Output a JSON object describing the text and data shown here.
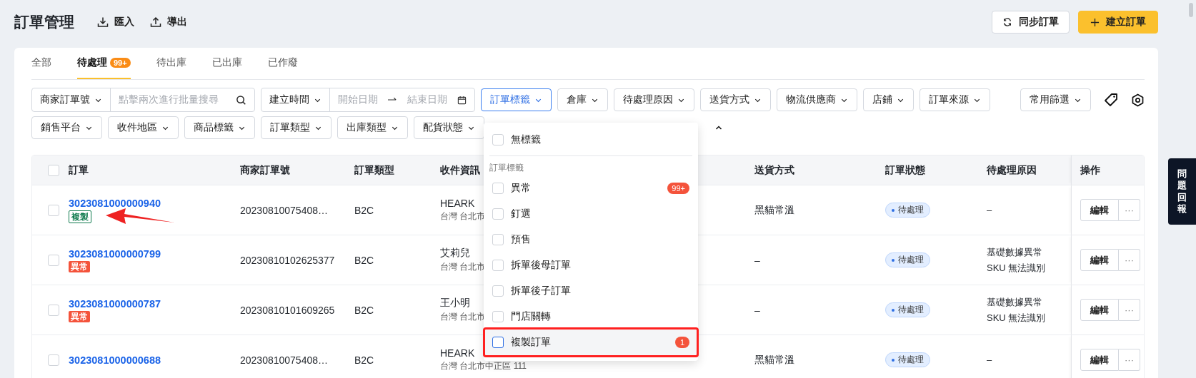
{
  "header": {
    "title": "訂單管理",
    "actions": [
      {
        "label": "匯入"
      },
      {
        "label": "導出"
      }
    ],
    "buttons": [
      {
        "label": "同步訂單",
        "kind": "secondary"
      },
      {
        "label": "建立訂單",
        "kind": "primary"
      }
    ]
  },
  "tabs": [
    {
      "label": "全部",
      "selected": false
    },
    {
      "label": "待處理",
      "selected": true,
      "badge": "99+"
    },
    {
      "label": "待出庫",
      "selected": false
    },
    {
      "label": "已出庫",
      "selected": false
    },
    {
      "label": "已作廢",
      "selected": false
    }
  ],
  "filters": {
    "row_1": [
      {
        "kind": "search",
        "label": "商家訂單號",
        "placeholder": "點擊兩次進行批量搜尋"
      },
      {
        "kind": "date",
        "label": "建立時間",
        "start_placeholder": "開始日期",
        "end_placeholder": "結束日期"
      },
      {
        "kind": "select",
        "label": "訂單標籤",
        "open": true
      },
      {
        "kind": "select",
        "label": "倉庫",
        "open": false
      },
      {
        "kind": "select",
        "label": "待處理原因",
        "open": false
      },
      {
        "kind": "select",
        "label": "送貨方式",
        "open": false
      },
      {
        "kind": "select",
        "label": "物流供應商",
        "open": false
      },
      {
        "kind": "select",
        "label": "店鋪",
        "open": false
      },
      {
        "kind": "select",
        "label": "訂單來源",
        "open": false
      }
    ],
    "saved_filters": "常用篩選",
    "row_2": [
      {
        "kind": "select",
        "label": "銷售平台",
        "open": false
      },
      {
        "kind": "select",
        "label": "收件地區",
        "open": false
      },
      {
        "kind": "select",
        "label": "商品標籤",
        "open": false
      },
      {
        "kind": "select",
        "label": "訂單類型",
        "open": false
      },
      {
        "kind": "select",
        "label": "出庫類型",
        "open": false
      },
      {
        "kind": "select",
        "label": "配貨狀態",
        "open": false
      }
    ]
  },
  "table": {
    "select_all_checked": false,
    "columns": [
      "訂單",
      "商家訂單號",
      "訂單類型",
      "收件資訊",
      "送貨方式",
      "訂單狀態",
      "待處理原因",
      "操作"
    ],
    "rows": [
      {
        "order": "3023081000000940",
        "tag": {
          "label": "複製",
          "kind": "copy"
        },
        "marked": true,
        "checked": false,
        "merchant_no": "20230810075408…",
        "type": "B2C",
        "recipient": "HEARK",
        "address": "台灣 台北市",
        "delivery": "黑貓常溫",
        "status": "待處理",
        "reason": [
          "–"
        ],
        "edit": "編輯",
        "more": "···"
      },
      {
        "order": "3023081000000799",
        "tag": {
          "label": "異常",
          "kind": "abnormal"
        },
        "marked": false,
        "checked": false,
        "merchant_no": "20230810102625377",
        "type": "B2C",
        "recipient": "艾莉兒",
        "address": "台灣 台北市",
        "delivery": "–",
        "status": "待處理",
        "reason": [
          "基礎數據異常",
          "SKU 無法識別"
        ],
        "edit": "編輯",
        "more": "···"
      },
      {
        "order": "3023081000000787",
        "tag": {
          "label": "異常",
          "kind": "abnormal"
        },
        "marked": false,
        "checked": false,
        "merchant_no": "20230810101609265",
        "type": "B2C",
        "recipient": "王小明",
        "address": "台灣 台北市",
        "delivery": "–",
        "status": "待處理",
        "reason": [
          "基礎數據異常",
          "SKU 無法識別"
        ],
        "edit": "編輯",
        "more": "···"
      },
      {
        "order": "3023081000000688",
        "marked": false,
        "checked": false,
        "merchant_no": "20230810075408…",
        "type": "B2C",
        "recipient": "HEARK",
        "address": "台灣 台北市中正區 111",
        "delivery": "黑貓常溫",
        "status": "待處理",
        "reason": [
          "–"
        ],
        "edit": "編輯",
        "more": "···"
      }
    ]
  },
  "dropdown": {
    "top_item": {
      "label": "無標籤",
      "checked": false
    },
    "group_label": "訂單標籤",
    "items": [
      {
        "label": "異常",
        "checked": false,
        "count": "99+",
        "hovered": false,
        "marked": false
      },
      {
        "label": "釘選",
        "checked": false,
        "hovered": false,
        "marked": false
      },
      {
        "label": "預售",
        "checked": false,
        "hovered": false,
        "marked": false
      },
      {
        "label": "拆單後母訂單",
        "checked": false,
        "hovered": false,
        "marked": false
      },
      {
        "label": "拆單後子訂單",
        "checked": false,
        "hovered": false,
        "marked": false
      },
      {
        "label": "門店關轉",
        "checked": false,
        "hovered": false,
        "marked": false
      },
      {
        "label": "複製訂單",
        "checked": false,
        "count": "1",
        "hovered": true,
        "marked": true
      }
    ]
  },
  "feedback_tab": "問題回報"
}
